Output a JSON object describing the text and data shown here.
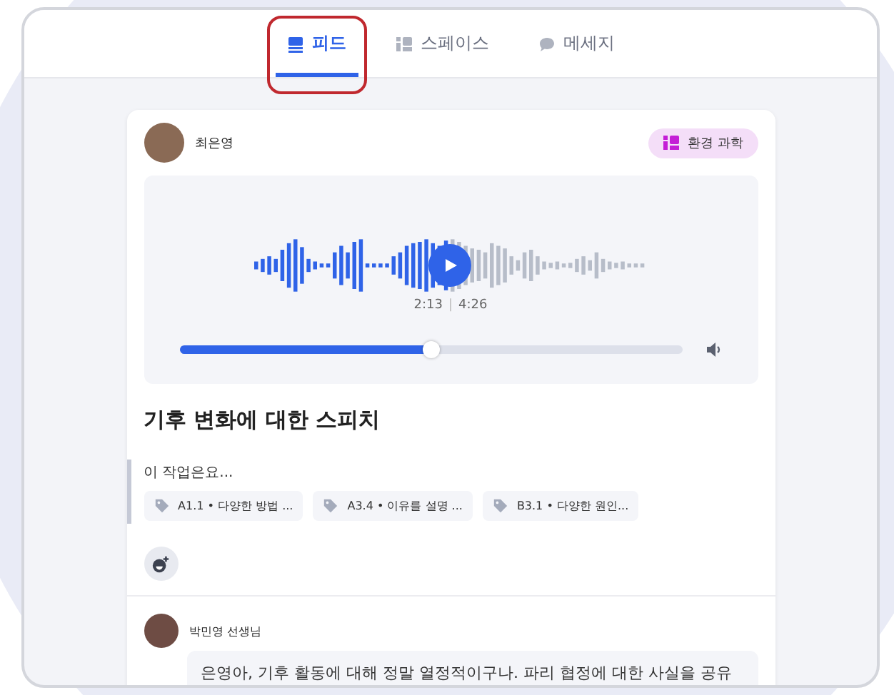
{
  "tabs": [
    {
      "label": "피드",
      "kind": "feed",
      "selected": true
    },
    {
      "label": "스페이스",
      "kind": "spaces",
      "selected": false
    },
    {
      "label": "메세지",
      "kind": "message",
      "selected": false
    }
  ],
  "post": {
    "author": "최은영",
    "tag": "환경 과학",
    "audio": {
      "current": "2:13",
      "separator": "|",
      "total": "4:26",
      "level": 0.5
    },
    "title": "기후 변화에 대한 스피치",
    "task_label": "이 작업은요...",
    "standards": [
      "A1.1 • 다양한 방법 ...",
      "A3.4 • 이유를 설명 ...",
      "B3.1 • 다양한 원인..."
    ]
  },
  "comment": {
    "author": "박민영 선생님",
    "text": "은영아, 기후 활동에 대해 정말 열정적이구나. 파리 협정에 대한 사실을 공유"
  }
}
